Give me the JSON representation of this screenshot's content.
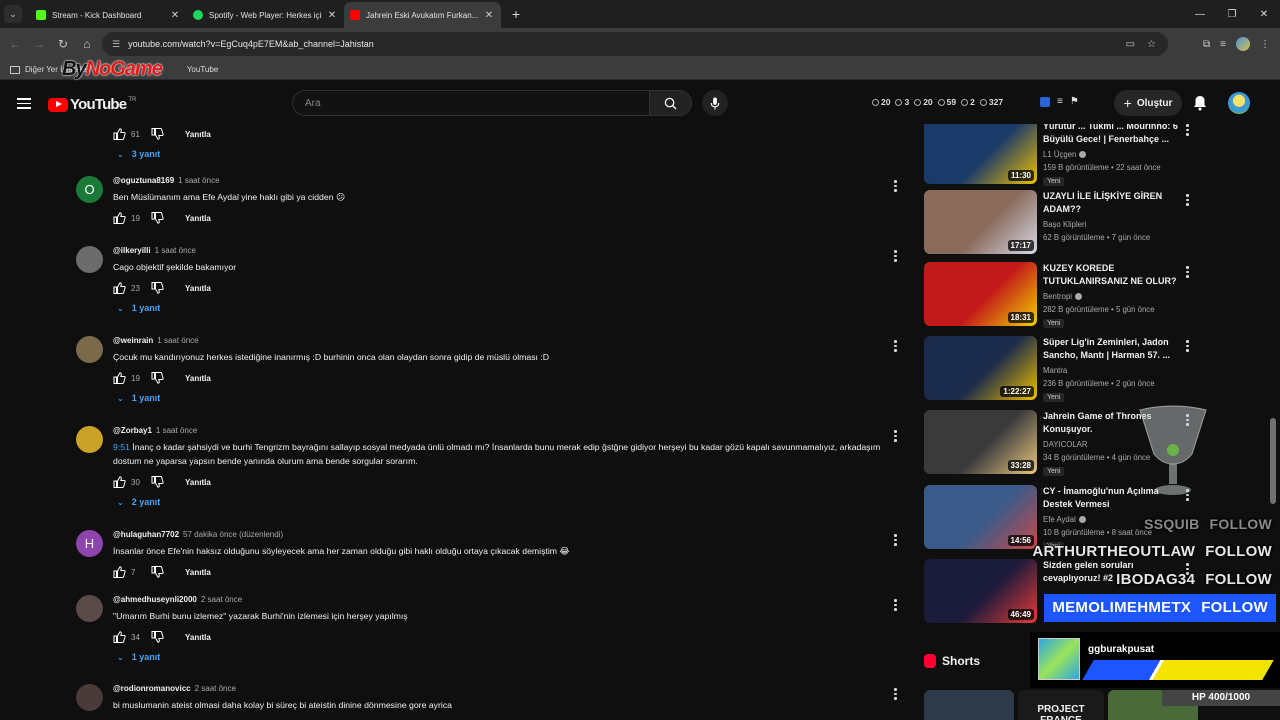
{
  "browser": {
    "tabs": [
      {
        "title": "Stream - Kick Dashboard",
        "icon": "kick-icon",
        "color": "#53fc18",
        "active": false
      },
      {
        "title": "Spotify - Web Player: Herkes için",
        "icon": "spotify-icon",
        "color": "#1ed760",
        "active": false
      },
      {
        "title": "Jahrein Eski Avukatım Furkan...",
        "icon": "youtube-icon",
        "color": "#ff0000",
        "active": true
      }
    ],
    "url": "youtube.com/watch?v=EgCuq4pE7EM&ab_channel=Jahistan",
    "bookmarks": {
      "folder": "Diğer Yer İşaretleri",
      "item": "YouTube"
    }
  },
  "watermark": {
    "part1": "By",
    "part2": "NoGame"
  },
  "youtube": {
    "logo_text": "YouTube",
    "country": "TR",
    "search_placeholder": "Ara",
    "stats": [
      "20",
      "3",
      "20",
      "59",
      "2",
      "327"
    ],
    "create_label": "Oluştur"
  },
  "top_reply": {
    "likes": "61",
    "reply": "Yanıtla",
    "replies": "3 yanıt"
  },
  "comments": [
    {
      "avatar_letter": "O",
      "avatar_color": "#1b7a3a",
      "user": "@oguztuna8169",
      "time": "1 saat önce",
      "text": "Ben Müslümanım ama Efe Aydal yine haklı gibi ya cidden 😕",
      "likes": "19",
      "reply": "Yanıtla",
      "replies": ""
    },
    {
      "avatar_letter": "",
      "avatar_color": "#6c6c6c",
      "user": "@ilkeryilli",
      "time": "1 saat önce",
      "text": "Cago objektif şekilde bakamıyor",
      "likes": "23",
      "reply": "Yanıtla",
      "replies": "1 yanıt"
    },
    {
      "avatar_letter": "",
      "avatar_color": "#7b6a4a",
      "user": "@weinrain",
      "time": "1 saat önce",
      "text": "Çocuk mu kandırıyonuz herkes istediğine inanırmış :D burhinin onca olan olaydan sonra gidip de müslü olması :D",
      "likes": "19",
      "reply": "Yanıtla",
      "replies": "1 yanıt"
    },
    {
      "avatar_letter": "",
      "avatar_color": "#c9a227",
      "user": "@Zorbay1",
      "time": "1 saat önce",
      "timestamp": "9:51",
      "text": " İnanç o kadar şahsiydi ve burhi Tengrizm bayrağını sallayıp sosyal medyada ünlü olmadı mı? İnsanlarda bunu merak edip ğstğne gidiyor herşeyi bu kadar gözü kapalı savunmamalıyız, arkadaşım dostum ne yaparsa yapsın bende yanında olurum ama bende sorgular sorarım.",
      "likes": "30",
      "reply": "Yanıtla",
      "replies": "2 yanıt"
    },
    {
      "avatar_letter": "H",
      "avatar_color": "#8e44ad",
      "user": "@hulaguhan7702",
      "time": "57 dakika önce (düzenlendi)",
      "text": "İnsanlar önce Efe'nin  haksız olduğunu söyleyecek ama her zaman olduğu gibi haklı olduğu ortaya çıkacak demiştim 😂",
      "likes": "7",
      "reply": "Yanıtla",
      "replies": ""
    },
    {
      "avatar_letter": "",
      "avatar_color": "#5a4a4a",
      "user": "@ahmedhuseynli2000",
      "time": "2 saat önce",
      "text": "\"Umarım Burhi bunu izlemez\" yazarak Burhi'nin izlemesi için herşey yapılmış",
      "likes": "34",
      "reply": "Yanıtla",
      "replies": "1 yanıt"
    },
    {
      "avatar_letter": "",
      "avatar_color": "#4a3a3a",
      "user": "@rodionromanovicc",
      "time": "2 saat önce",
      "text": "bi muslumanin ateist olmasi daha kolay bi süreç bi ateistin dinine dönmesine gore ayrica",
      "likes": "",
      "reply": "",
      "replies": ""
    }
  ],
  "sidebar": {
    "videos": [
      {
        "title": "Yürütür ... Tukmi ... Mourinho: 6 Büyülü Gece! | Fenerbahçe ...",
        "channel": "L1 Üçgen",
        "verified": true,
        "views": "159 B görüntüleme",
        "age": "22 saat önce",
        "badge": "Yeni",
        "duration": "11:30",
        "thumb_colors": [
          "#1a3a6a",
          "#f2c200"
        ]
      },
      {
        "title": "UZAYLI İLE İLİŞKİYE GİREN ADAM??",
        "channel": "Başo Klipleri",
        "verified": false,
        "views": "62 B görüntüleme",
        "age": "7 gün önce",
        "badge": "",
        "duration": "17:17",
        "thumb_colors": [
          "#8a6a5a",
          "#d8d8e8"
        ]
      },
      {
        "title": "KUZEY KOREDE TUTUKLANIRSANIZ NE OLUR?",
        "channel": "Bentropi",
        "verified": true,
        "views": "282 B görüntüleme",
        "age": "5 gün önce",
        "badge": "Yeni",
        "duration": "18:31",
        "thumb_colors": [
          "#c21a1a",
          "#f2d200"
        ]
      },
      {
        "title": "Süper Lig'in Zeminleri, Jadon Sancho, Mantı | Harman 57. ...",
        "channel": "Mantra",
        "verified": false,
        "views": "236 B görüntüleme",
        "age": "2 gün önce",
        "badge": "Yeni",
        "duration": "1:22:27",
        "thumb_colors": [
          "#1a2a4a",
          "#f2c200"
        ]
      },
      {
        "title": "Jahrein Game of Thrones Konuşuyor.",
        "channel": "DAYICOLAR",
        "verified": false,
        "views": "34 B görüntüleme",
        "age": "4 gün önce",
        "badge": "Yeni",
        "duration": "33:28",
        "thumb_colors": [
          "#3a3a3a",
          "#e8c880"
        ]
      },
      {
        "title": "CY - İmamoğlu'nun Açılıma Destek Vermesi",
        "channel": "Efe Aydal",
        "verified": true,
        "views": "10 B görüntüleme",
        "age": "8 saat önce",
        "badge": "Yeni",
        "duration": "14:56",
        "thumb_colors": [
          "#3a5a8a",
          "#c84a4a"
        ]
      },
      {
        "title": "Sizden gelen soruları cevaplıyoruz! #2",
        "channel": "",
        "verified": false,
        "views": "",
        "age": "",
        "badge": "",
        "duration": "46:49",
        "thumb_colors": [
          "#1a1a3a",
          "#e83a3a"
        ]
      }
    ],
    "shorts_label": "Shorts",
    "short_text": "PROJECT FRANCE"
  },
  "overlay": {
    "follows": [
      {
        "name": "SSQUIB",
        "label": "FOLLOW",
        "style": "dim"
      },
      {
        "name": "ARTHURTHEOUTLAW",
        "label": "FOLLOW",
        "style": "normal"
      },
      {
        "name": "IBODAG34",
        "label": "FOLLOW",
        "style": "normal"
      },
      {
        "name": "MEMOLIMEHMETX",
        "label": "FOLLOW",
        "style": "hi"
      }
    ],
    "player_name": "ggburakpusat",
    "hp_text": "HP 400/1000",
    "hp_fraction": 0.4
  }
}
